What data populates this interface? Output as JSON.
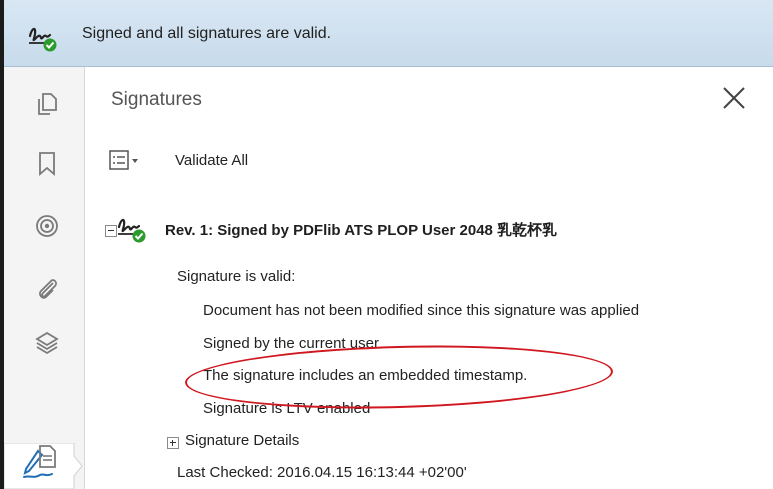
{
  "banner": {
    "message": "Signed and all signatures are valid."
  },
  "panel": {
    "title": "Signatures",
    "validate_all": "Validate All",
    "revision": {
      "title": "Rev. 1: Signed by PDFlib ATS PLOP User 2048 乳乾杯乳",
      "status": "Signature is valid:",
      "details": [
        "Document has not been modified since this signature was applied",
        "Signed by the current user",
        "The signature includes an embedded timestamp.",
        "Signature is LTV enabled"
      ],
      "signature_details": "Signature Details",
      "last_checked": "Last Checked: 2016.04.15 16:13:44 +02'00'"
    }
  },
  "rail": {
    "icons": [
      "pages-icon",
      "bookmark-icon",
      "target-icon",
      "attachment-icon",
      "layers-icon",
      "signature-pen-icon",
      "document-icon"
    ]
  },
  "colors": {
    "banner_bg": "#d0e2f0",
    "valid_green": "#2d9a2d",
    "annotation_red": "#d0161e"
  }
}
